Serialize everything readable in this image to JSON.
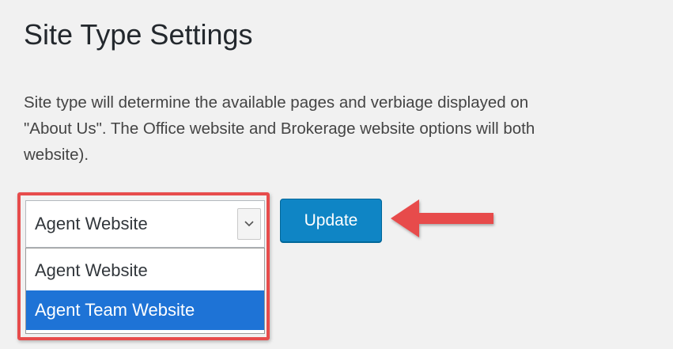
{
  "page": {
    "title": "Site Type Settings",
    "description_lines": [
      "Site type will determine the available pages and verbiage displayed on",
      "\"About Us\". The Office website and Brokerage website options will both",
      "website)."
    ]
  },
  "site_type_select": {
    "current_value": "Agent Website",
    "options": [
      {
        "label": "Agent Website",
        "selected": false
      },
      {
        "label": "Agent Team Website",
        "selected": true
      }
    ]
  },
  "actions": {
    "update_label": "Update"
  },
  "icons": {
    "select_arrow": "chevron-down-icon",
    "annotation": "red-arrow-left-icon"
  },
  "colors": {
    "background": "#f1f1f1",
    "primary_button": "#0f85c5",
    "highlight_option": "#1e73d6",
    "annotation_red": "#e74c4c"
  }
}
